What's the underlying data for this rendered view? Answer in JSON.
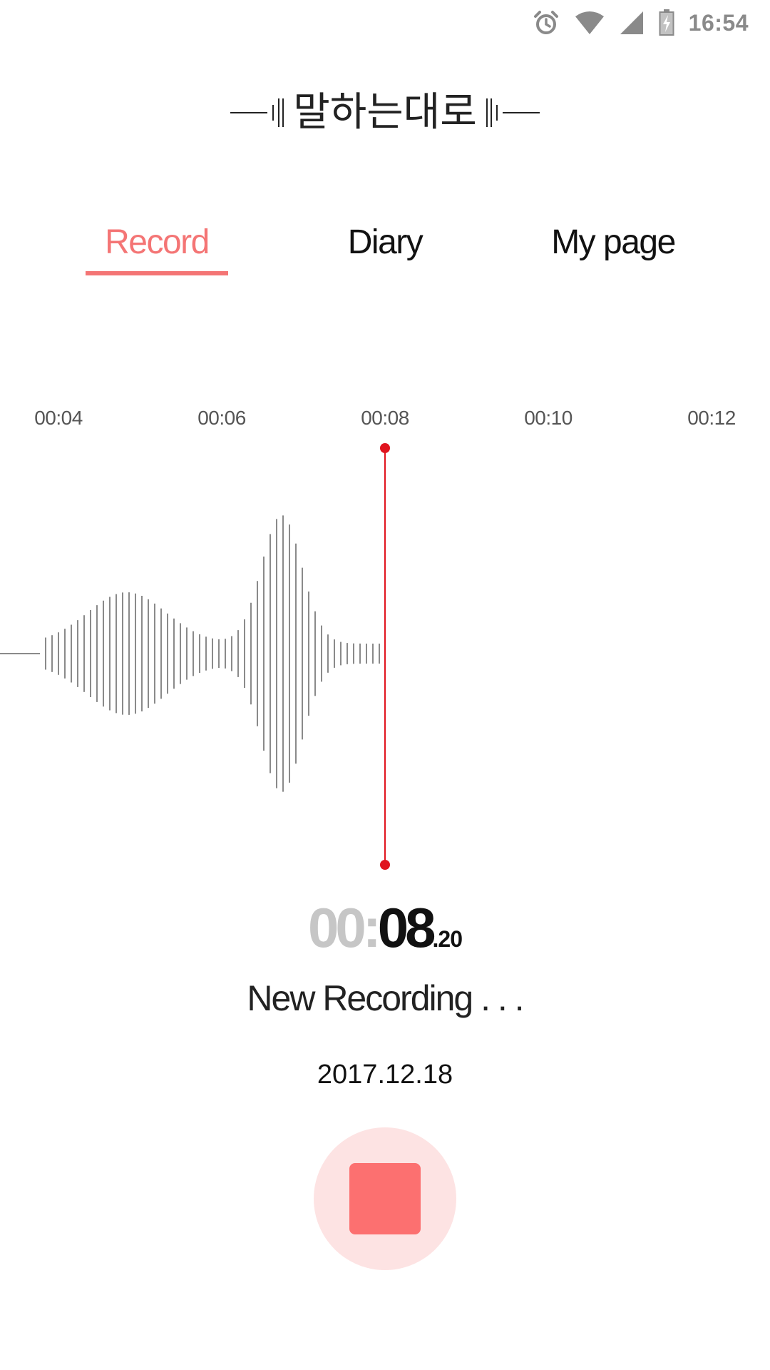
{
  "status_bar": {
    "time": "16:54",
    "icons": [
      "alarm-icon",
      "wifi-icon",
      "cell-signal-icon",
      "battery-charging-icon"
    ]
  },
  "app": {
    "title": "말하는대로"
  },
  "tabs": [
    {
      "label": "Record",
      "active": true
    },
    {
      "label": "Diary",
      "active": false
    },
    {
      "label": "My page",
      "active": false
    }
  ],
  "timeline": {
    "ticks": [
      "00:04",
      "00:06",
      "00:08",
      "00:10",
      "00:12"
    ]
  },
  "timer": {
    "minutes": "00:",
    "seconds": "08",
    "fraction": ".20"
  },
  "recording": {
    "name": "New Recording . . .",
    "date": "2017.12.18"
  },
  "colors": {
    "accent": "#f47575",
    "playhead": "#e0141e",
    "wave": "#8a8a8a",
    "stop_bg": "#fde3e3",
    "stop_fg": "#fc7070"
  }
}
